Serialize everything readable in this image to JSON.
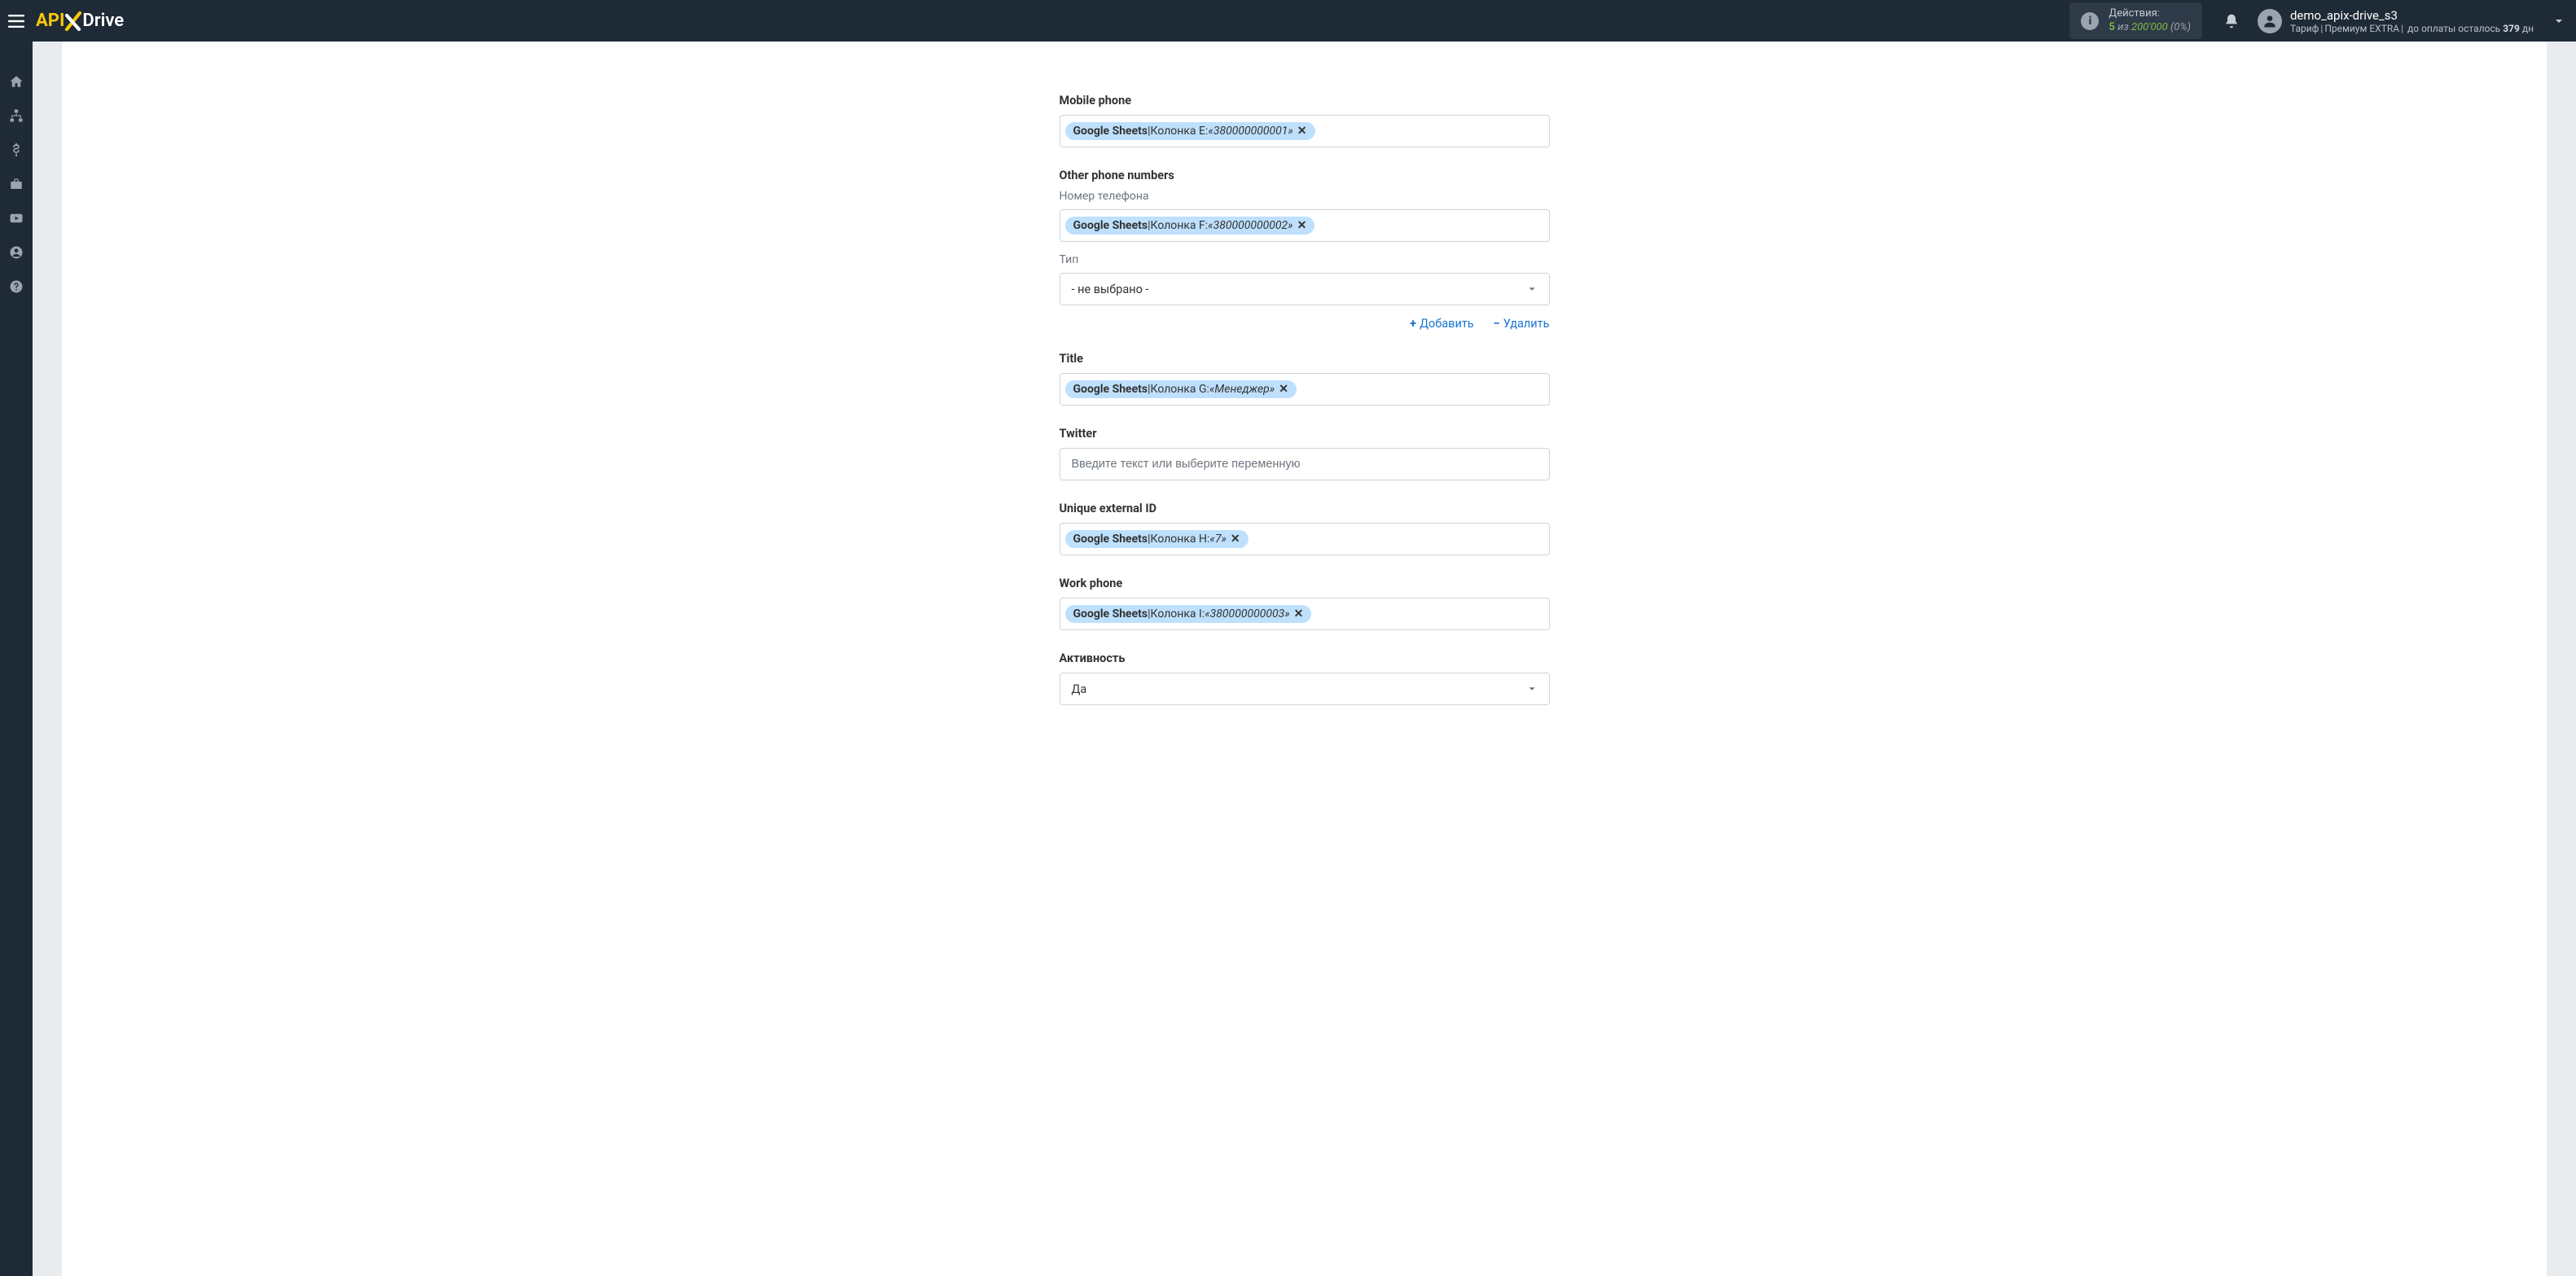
{
  "header": {
    "actions_label": "Действия:",
    "actions_used": "5",
    "actions_of": "из",
    "actions_total": "200'000",
    "actions_pct": "(0%)",
    "user_name": "demo_apix-drive_s3",
    "plan_prefix": "Тариф",
    "plan_name": "Премиум EXTRA",
    "plan_pay_prefix": "до оплаты осталось",
    "plan_days": "379",
    "plan_days_suffix": "дн"
  },
  "form": {
    "placeholder": "Введите текст или выберите переменную",
    "add_label": "Добавить",
    "delete_label": "Удалить",
    "not_selected": "- не выбрано -",
    "fields": {
      "mobile": {
        "label": "Mobile phone",
        "tag_src": "Google Sheets",
        "tag_col": "Колонка E:",
        "tag_val": "«380000000001»"
      },
      "other": {
        "label": "Other phone numbers",
        "sub1": "Номер телефона",
        "tag_src": "Google Sheets",
        "tag_col": "Колонка F:",
        "tag_val": "«380000000002»",
        "sub2": "Тип"
      },
      "title": {
        "label": "Title",
        "tag_src": "Google Sheets",
        "tag_col": "Колонка G:",
        "tag_val": "«Менеджер»"
      },
      "twitter": {
        "label": "Twitter"
      },
      "extid": {
        "label": "Unique external ID",
        "tag_src": "Google Sheets",
        "tag_col": "Колонка H:",
        "tag_val": "«7»"
      },
      "workphone": {
        "label": "Work phone",
        "tag_src": "Google Sheets",
        "tag_col": "Колонка I:",
        "tag_val": "«380000000003»"
      },
      "activity": {
        "label": "Активность",
        "value": "Да"
      }
    }
  }
}
